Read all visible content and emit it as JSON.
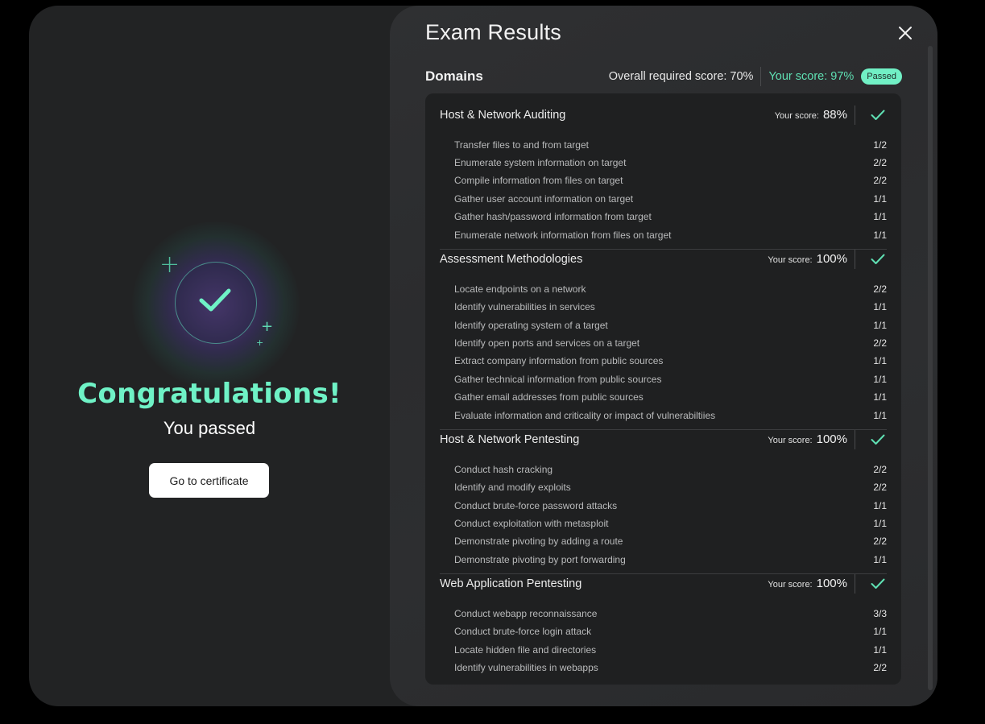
{
  "left": {
    "congrats": "Congratulations!",
    "subtitle": "You passed",
    "certificate_button": "Go to certificate",
    "badge_icon": "check-icon",
    "sparkle_glyph": "+"
  },
  "results": {
    "title": "Exam Results",
    "close_icon": "close-icon",
    "domains_label": "Domains",
    "required_label": "Overall required score:",
    "required_value": "70%",
    "your_label": "Your score:",
    "your_value": "97%",
    "status": "Passed",
    "accent_color": "#5fe0b3"
  },
  "domains": [
    {
      "name": "Host & Network Auditing",
      "score_label": "Your score:",
      "score": "88%",
      "objectives": [
        {
          "label": "Transfer files to and from target",
          "score": "1/2"
        },
        {
          "label": "Enumerate system information on target",
          "score": "2/2"
        },
        {
          "label": "Compile information from files on target",
          "score": "2/2"
        },
        {
          "label": "Gather user account information on target",
          "score": "1/1"
        },
        {
          "label": "Gather hash/password information from target",
          "score": "1/1"
        },
        {
          "label": "Enumerate network information from files on target",
          "score": "1/1"
        }
      ]
    },
    {
      "name": "Assessment Methodologies",
      "score_label": "Your score:",
      "score": "100%",
      "objectives": [
        {
          "label": "Locate endpoints on a network",
          "score": "2/2"
        },
        {
          "label": "Identify vulnerabilities in services",
          "score": "1/1"
        },
        {
          "label": "Identify operating system of a target",
          "score": "1/1"
        },
        {
          "label": "Identify open ports and services on a target",
          "score": "2/2"
        },
        {
          "label": "Extract company information from public sources",
          "score": "1/1"
        },
        {
          "label": "Gather technical information from public sources",
          "score": "1/1"
        },
        {
          "label": "Gather email addresses from public sources",
          "score": "1/1"
        },
        {
          "label": "Evaluate information and criticality or impact of vulnerabiltiies",
          "score": "1/1"
        }
      ]
    },
    {
      "name": "Host & Network Pentesting",
      "score_label": "Your score:",
      "score": "100%",
      "objectives": [
        {
          "label": "Conduct hash cracking",
          "score": "2/2"
        },
        {
          "label": "Identify and modify exploits",
          "score": "2/2"
        },
        {
          "label": "Conduct brute-force password attacks",
          "score": "1/1"
        },
        {
          "label": "Conduct exploitation with metasploit",
          "score": "1/1"
        },
        {
          "label": "Demonstrate pivoting by adding a route",
          "score": "2/2"
        },
        {
          "label": "Demonstrate pivoting by port forwarding",
          "score": "1/1"
        }
      ]
    },
    {
      "name": "Web Application Pentesting",
      "score_label": "Your score:",
      "score": "100%",
      "objectives": [
        {
          "label": "Conduct webapp reconnaissance",
          "score": "3/3"
        },
        {
          "label": "Conduct brute-force login attack",
          "score": "1/1"
        },
        {
          "label": "Locate hidden file and directories",
          "score": "1/1"
        },
        {
          "label": "Identify vulnerabilities in webapps",
          "score": "2/2"
        }
      ]
    }
  ]
}
